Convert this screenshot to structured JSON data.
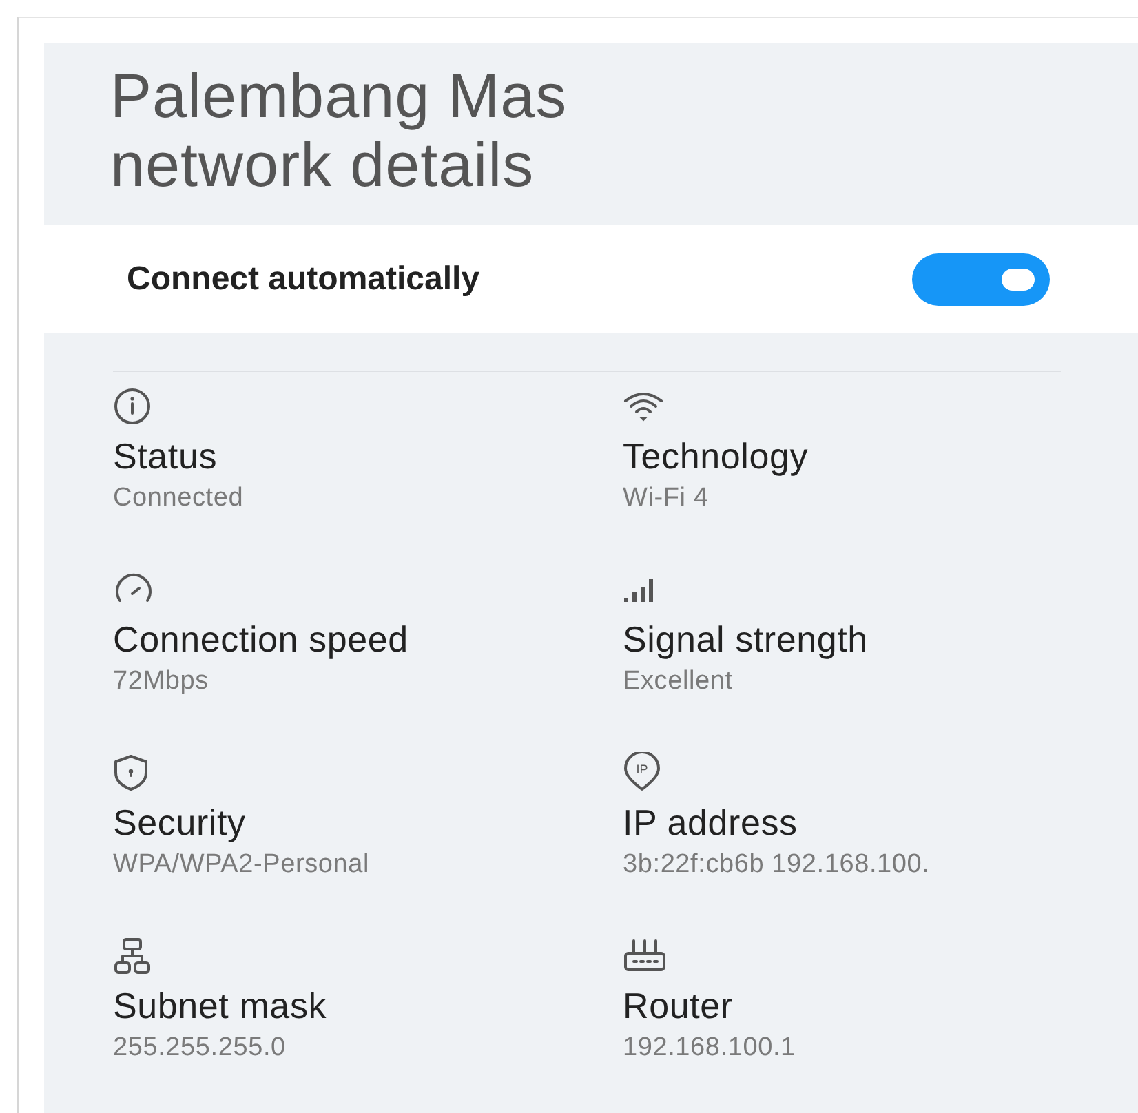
{
  "title_lines": [
    "Palembang Mas",
    "network details"
  ],
  "connect_automatically": {
    "label": "Connect automatically",
    "on": true
  },
  "detail_rows": [
    [
      {
        "label": "Status",
        "value": "Connected"
      },
      {
        "label": "Technology",
        "value": "Wi-Fi 4"
      }
    ],
    [
      {
        "label": "Connection speed",
        "value": "72Mbps"
      },
      {
        "label": "Signal strength",
        "value": "Excellent"
      }
    ],
    [
      {
        "label": "Security",
        "value": "WPA/WPA2-Personal"
      },
      {
        "label": "IP address",
        "value": "3b:22f:cb6b 192.168.100.",
        "icon_text": "IP"
      }
    ],
    [
      {
        "label": "Subnet mask",
        "value": "255.255.255.0"
      },
      {
        "label": "Router",
        "value": "192.168.100.1"
      }
    ]
  ]
}
